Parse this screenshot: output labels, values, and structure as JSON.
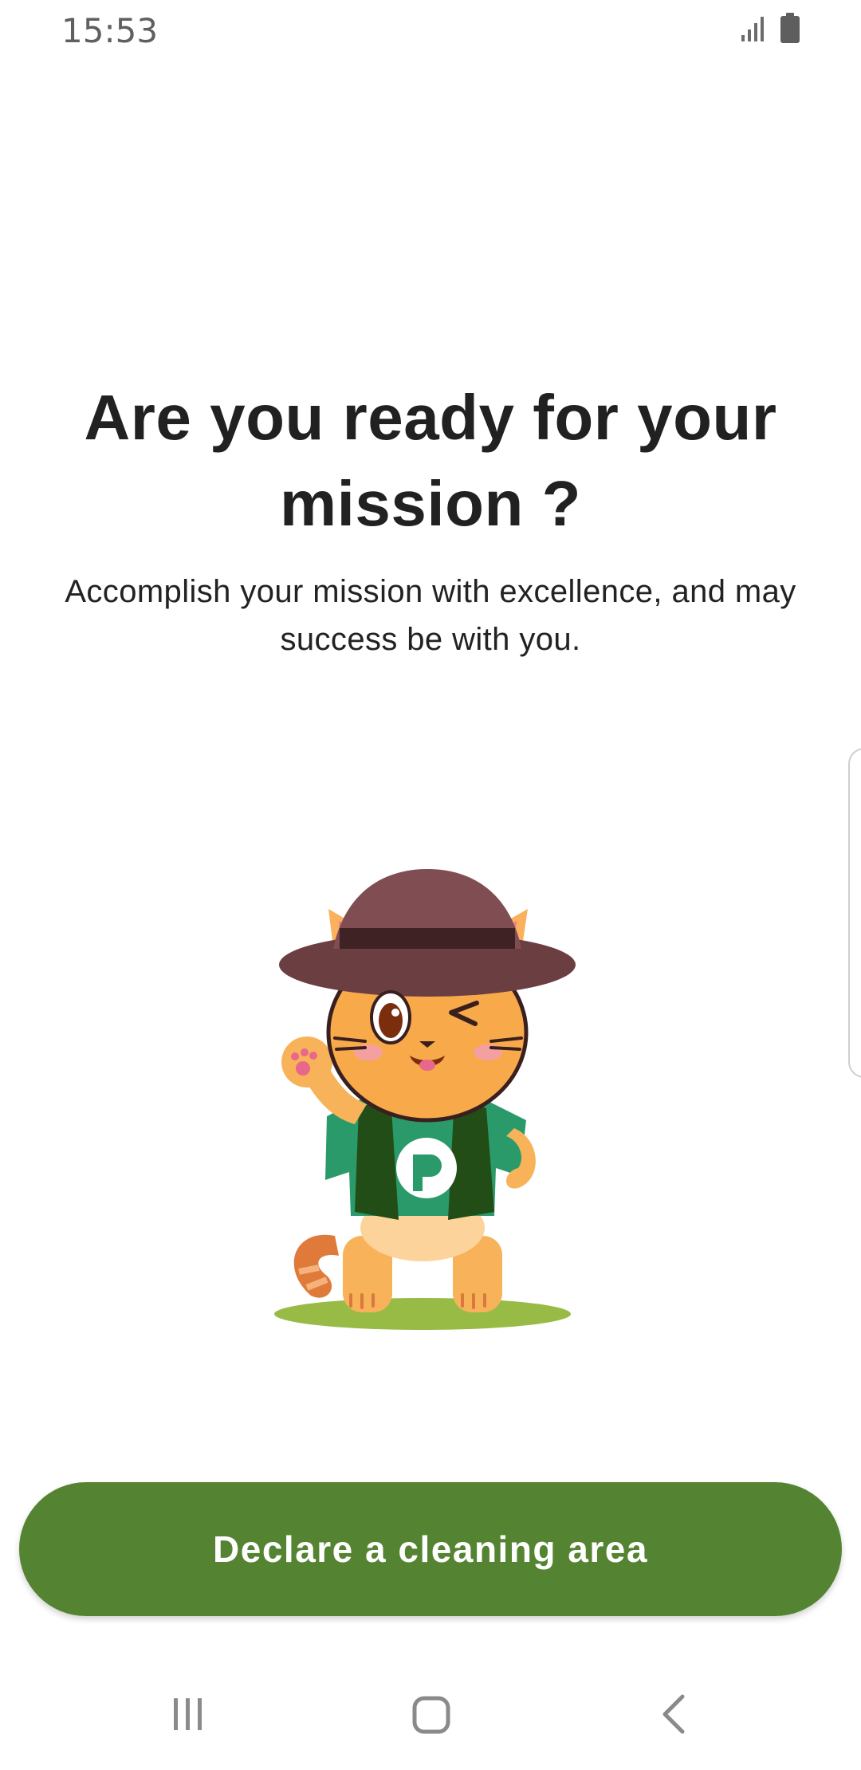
{
  "status_bar": {
    "time": "15:53",
    "icons": [
      "signal-icon",
      "battery-icon"
    ]
  },
  "main": {
    "title": "Are you ready for your mission ?",
    "subtitle": "Accomplish your mission with excellence, and may success be with you.",
    "illustration": "cat-explorer-mascot"
  },
  "cta": {
    "label": "Declare a cleaning area"
  },
  "nav_bar": {
    "icons": [
      "recents-icon",
      "home-icon",
      "back-icon"
    ]
  },
  "colors": {
    "accent": "#548431",
    "title_text": "#212121",
    "body_text": "#222222"
  }
}
